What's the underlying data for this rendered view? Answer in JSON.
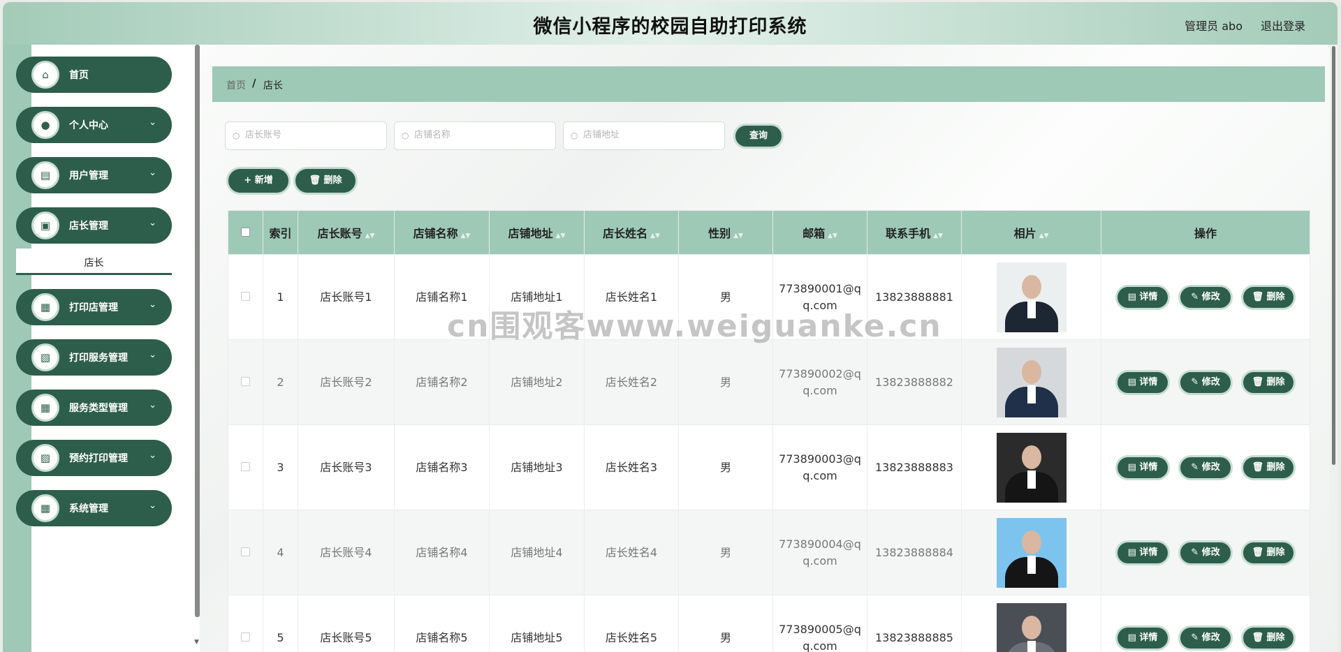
{
  "header": {
    "title": "微信小程序的校园自助打印系统",
    "user": "管理员 abo",
    "logout": "退出登录"
  },
  "sidebar": {
    "items": [
      {
        "label": "首页",
        "icon": "home-icon",
        "glyph": "⌂",
        "chevron": false
      },
      {
        "label": "个人中心",
        "icon": "user-icon",
        "glyph": "●",
        "chevron": true
      },
      {
        "label": "用户管理",
        "icon": "briefcase-icon",
        "glyph": "▤",
        "chevron": true
      },
      {
        "label": "店长管理",
        "icon": "chart-icon",
        "glyph": "▣",
        "chevron": true
      },
      {
        "label": "打印店管理",
        "icon": "grid-icon",
        "glyph": "▦",
        "chevron": true
      },
      {
        "label": "打印服务管理",
        "icon": "clipboard-icon",
        "glyph": "▧",
        "chevron": true
      },
      {
        "label": "服务类型管理",
        "icon": "grid-icon",
        "glyph": "▦",
        "chevron": true
      },
      {
        "label": "预约打印管理",
        "icon": "bag-icon",
        "glyph": "▨",
        "chevron": true
      },
      {
        "label": "系统管理",
        "icon": "grid-icon",
        "glyph": "▦",
        "chevron": true
      }
    ],
    "submenu": "店长"
  },
  "breadcrumb": {
    "home": "首页",
    "sep": "/",
    "current": "店长"
  },
  "search": {
    "fields": [
      {
        "placeholder": "店长账号"
      },
      {
        "placeholder": "店铺名称"
      },
      {
        "placeholder": "店铺地址"
      }
    ],
    "query": "查询"
  },
  "toolbar": {
    "add": "+ 新增",
    "delete": "🗑 删除"
  },
  "table": {
    "headers": [
      "索引",
      "店长账号",
      "店铺名称",
      "店铺地址",
      "店长姓名",
      "性别",
      "邮箱",
      "联系手机",
      "相片",
      "操作"
    ],
    "rows": [
      {
        "index": "1",
        "account": "店长账号1",
        "shop": "店铺名称1",
        "address": "店铺地址1",
        "name": "店长姓名1",
        "gender": "男",
        "email": "773890001@qq.com",
        "phone": "13823888881"
      },
      {
        "index": "2",
        "account": "店长账号2",
        "shop": "店铺名称2",
        "address": "店铺地址2",
        "name": "店长姓名2",
        "gender": "男",
        "email": "773890002@qq.com",
        "phone": "13823888882"
      },
      {
        "index": "3",
        "account": "店长账号3",
        "shop": "店铺名称3",
        "address": "店铺地址3",
        "name": "店长姓名3",
        "gender": "男",
        "email": "773890003@qq.com",
        "phone": "13823888883"
      },
      {
        "index": "4",
        "account": "店长账号4",
        "shop": "店铺名称4",
        "address": "店铺地址4",
        "name": "店长姓名4",
        "gender": "男",
        "email": "773890004@qq.com",
        "phone": "13823888884"
      },
      {
        "index": "5",
        "account": "店长账号5",
        "shop": "店铺名称5",
        "address": "店铺地址5",
        "name": "店长姓名5",
        "gender": "男",
        "email": "773890005@qq.com",
        "phone": "13823888885"
      }
    ],
    "actions": {
      "detail": "详情",
      "edit": "修改",
      "delete": "删除"
    }
  },
  "watermark": "cn围观客www.weiguanke.cn",
  "colors": {
    "accent": "#2d5e4b",
    "header_bg": "#9ec9b6"
  }
}
